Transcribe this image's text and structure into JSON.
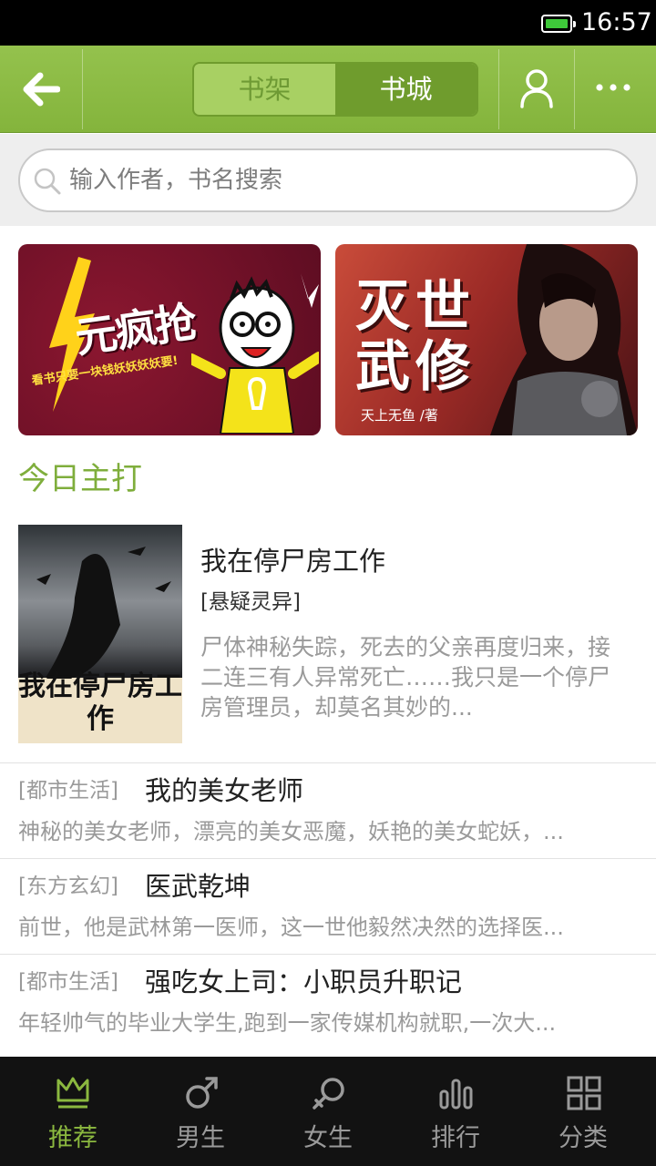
{
  "status_bar": {
    "time": "16:57",
    "battery_color": "#3ec93a"
  },
  "toolbar": {
    "tabs": [
      {
        "label": "书架",
        "selected": false
      },
      {
        "label": "书城",
        "selected": true
      }
    ],
    "icons": [
      "back-arrow-icon",
      "user-icon",
      "more-icon"
    ],
    "accent_color": "#8bb83f"
  },
  "search": {
    "placeholder": "输入作者，书名搜索",
    "value": ""
  },
  "banners": [
    {
      "title": "元疯抢",
      "subtitle": "看书只要一块钱妖妖妖妖要!"
    },
    {
      "title": "灭世武修",
      "author": "天上无鱼 /著"
    }
  ],
  "section": {
    "title": "今日主打"
  },
  "featured": {
    "cover_text": "我在停尸房工作",
    "title": "我在停尸房工作",
    "genre": "[悬疑灵异]",
    "description": "尸体神秘失踪，死去的父亲再度归来，接二连三有人异常死亡……我只是一个停尸房管理员，却莫名其妙的..."
  },
  "books": [
    {
      "tag": "[都市生活]",
      "title": "我的美女老师",
      "description": "神秘的美女老师，漂亮的美女恶魔，妖艳的美女蛇妖，..."
    },
    {
      "tag": "[东方玄幻]",
      "title": "医武乾坤",
      "description": "前世，他是武林第一医师，这一世他毅然决然的选择医..."
    },
    {
      "tag": "[都市生活]",
      "title": "强吃女上司：小职员升职记",
      "description": "年轻帅气的毕业大学生,跑到一家传媒机构就职,一次大..."
    }
  ],
  "bottom_nav": [
    {
      "label": "推荐",
      "icon": "crown-icon",
      "active": true
    },
    {
      "label": "男生",
      "icon": "male-icon",
      "active": false
    },
    {
      "label": "女生",
      "icon": "female-icon",
      "active": false
    },
    {
      "label": "排行",
      "icon": "bar-chart-icon",
      "active": false
    },
    {
      "label": "分类",
      "icon": "grid-icon",
      "active": false
    }
  ]
}
